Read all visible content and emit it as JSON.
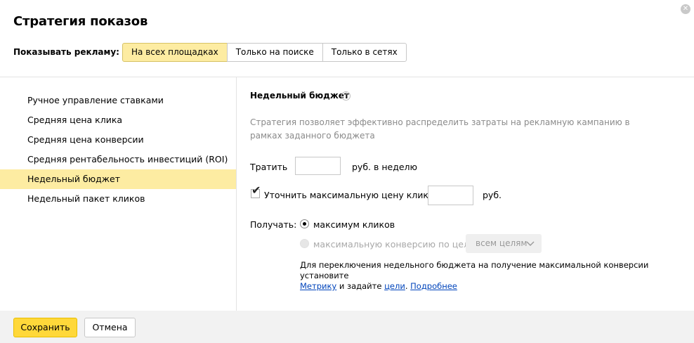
{
  "dialog": {
    "title": "Стратегия показов",
    "close_icon": "close-icon"
  },
  "show_ads": {
    "label": "Показывать рекламу:",
    "options": [
      "На всех площадках",
      "Только на поиске",
      "Только в сетях"
    ],
    "selected": "На всех площадках"
  },
  "strategies": {
    "items": [
      "Ручное управление ставками",
      "Средняя цена клика",
      "Средняя цена конверсии",
      "Средняя рентабельность инвестиций (ROI)",
      "Недельный бюджет",
      "Недельный пакет кликов"
    ],
    "selected": "Недельный бюджет"
  },
  "weekly_budget": {
    "title": "Недельный бюджет",
    "help_icon": "?",
    "description": "Стратегия позволяет эффективно распределить затраты на рекламную кампанию в рамках заданного бюджета",
    "spend_label": "Тратить",
    "spend_value": "",
    "spend_unit": "руб. в неделю",
    "max_cpc_label": "Уточнить максимальную цену клика",
    "max_cpc_checked": true,
    "max_cpc_value": "",
    "max_cpc_unit": "руб.",
    "receive_label": "Получать:",
    "option_max_clicks": "максимум кликов",
    "option_max_conversion": "максимальную конверсию по цели:",
    "goal_select": "всем целям",
    "note_text": "Для переключения недельного бюджета на получение максимальной конверсии установите",
    "note_link_metrika": "Метрику",
    "note_and": "и задайте",
    "note_link_goals": "цели",
    "note_link_more": "Подробнее"
  },
  "footer": {
    "save_label": "Сохранить",
    "cancel_label": "Отмена"
  },
  "colors": {
    "accent": "#ffd83a",
    "selected_bg": "#fdeca2",
    "link": "#0044bb"
  }
}
